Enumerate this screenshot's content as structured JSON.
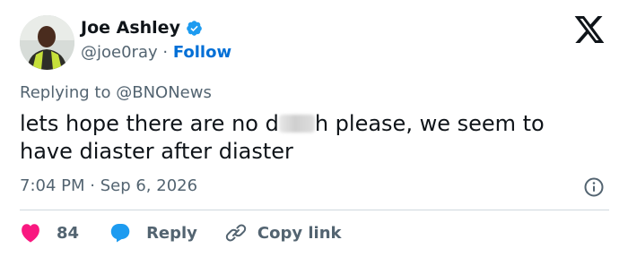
{
  "author": {
    "name": "Joe Ashley",
    "handle": "@joe0ray",
    "separator": "·",
    "follow_label": "Follow",
    "verified_icon": "verified-badge-icon",
    "verified_color": "#1d9bf0"
  },
  "platform_icon": "x-logo-icon",
  "reply_context": {
    "prefix": "Replying to",
    "mention": "@BNONews"
  },
  "tweet": {
    "text_before": "lets hope there are no d",
    "text_after": "h please, we seem to have diaster after diaster",
    "censored": true
  },
  "meta": {
    "timestamp": "7:04 PM · Sep 6, 2026",
    "info_icon": "info-icon"
  },
  "actions": {
    "like_count": "84",
    "like_icon": "heart-icon",
    "like_color": "#f91880",
    "reply_label": "Reply",
    "reply_icon": "speech-bubble-icon",
    "reply_color": "#1d9bf0",
    "copy_label": "Copy link",
    "copy_icon": "link-icon"
  },
  "colors": {
    "primary_text": "#0f1419",
    "secondary_text": "#536471",
    "link": "#006fd6",
    "divider": "#cfd9de"
  }
}
